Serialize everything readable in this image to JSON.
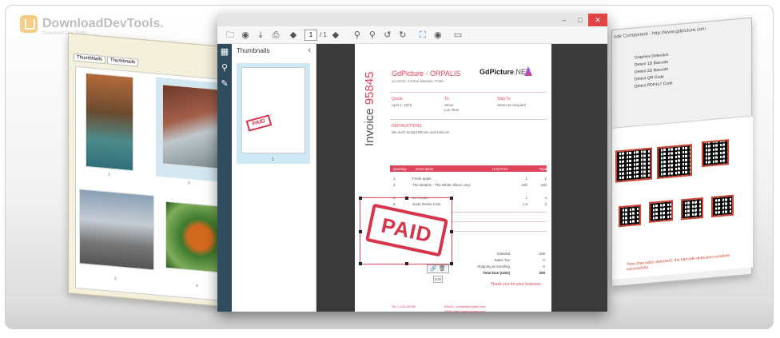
{
  "watermark": {
    "title": "DownloadDevTools.",
    "subtitle": "Download Dev Tools"
  },
  "left_window": {
    "tabs": [
      "ThumbNails",
      "Thumbnails"
    ],
    "captions": [
      "1",
      "2",
      "3",
      "4"
    ]
  },
  "right_window": {
    "address": "ode Component - http://www.gdpicture.com",
    "options": [
      "Graphics Detection",
      "Detect 1D Barcode",
      "Detect 2D Barcode",
      "Detect QR Code",
      "Detect PDF417 Code"
    ],
    "footer": "Time (barcodes detected): the barcode detection complete successfully"
  },
  "main_window": {
    "window_buttons": {
      "minimize": "–",
      "maximize": "□",
      "close": "✕"
    },
    "toolbar": {
      "open": "🗀",
      "globe": "◉",
      "download": "⤓",
      "print": "⎙",
      "prev": "◆",
      "page_current": "1",
      "page_total": "/ 1",
      "next": "◆",
      "zoom_in": "⚲",
      "zoom_out": "⚲",
      "rotate_left": "↺",
      "rotate_right": "↻",
      "fit": "⛶",
      "eye": "◉",
      "view": "▭"
    },
    "sidebar_icons": [
      "▦",
      "⚲",
      "✎"
    ],
    "thumbnails_title": "Thumbnails",
    "thumbnails_chevron": "‹",
    "thumb_page_number": "1",
    "mini_stamp": "PAID"
  },
  "invoice": {
    "vertical_title": "Invoice",
    "vertical_number": "95845",
    "company": "GdPicture - ORPALIS",
    "company_address": "1a Victor, 14 Rue Manitan, Fratis",
    "brand": "GdPicture",
    "brand_suffix": ".NET",
    "labels": {
      "quote": "Quote",
      "to": "To:",
      "ship_to": "Ship To",
      "instructions": "INSTRUCTIONS"
    },
    "quote_date": "April 1, 1976",
    "to_name": "Steve",
    "to_city": "Los Altos",
    "ship_to": "Same as recipient",
    "instructions_text": "We don't accept Bitcoin and Litecoin",
    "table_headers": [
      "Quantity",
      "Description",
      "Unit Price",
      "Total"
    ],
    "rows": [
      {
        "qty": "1",
        "desc": "Fresh apple",
        "price": "1",
        "total": "2"
      },
      {
        "qty": "2",
        "desc": "The Beatles - The White Album vinyl",
        "price": "200",
        "total": "200"
      },
      {
        "qty": "3",
        "desc": "Ice cream",
        "price": "1",
        "total": "4"
      },
      {
        "qty": "5",
        "desc": "Soda Drinks Cola",
        "price": "1.5",
        "total": "3"
      }
    ],
    "totals": [
      {
        "label": "Subtotal",
        "value": "209"
      },
      {
        "label": "Sales Tax",
        "value": "0"
      },
      {
        "label": "Shipping & Handling",
        "value": "0"
      },
      {
        "label": "Total Due (USD)",
        "value": "209"
      }
    ],
    "thanks": "Thank you for your business",
    "stamp_text": "PAID",
    "stamp_tools": "🔗 🗑",
    "stamp_edit": "Edit",
    "footer": [
      "Tel: 1-234-56789",
      "EMAIL: contact@orpalis.com",
      "WEB: http://www.orpalis.com"
    ]
  },
  "colors": {
    "accent": "#e0445a",
    "sidebar": "#2f4b5e",
    "close": "#e04343"
  }
}
